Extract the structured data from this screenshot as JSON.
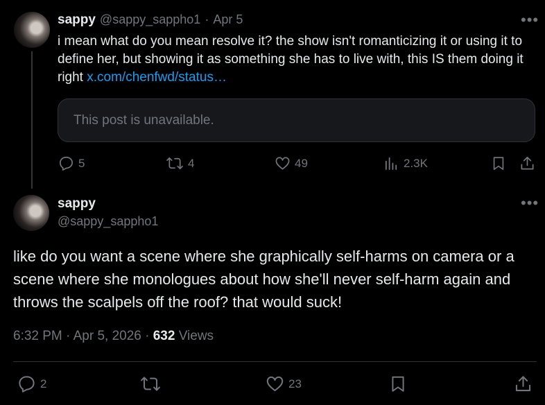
{
  "reply_post": {
    "author_name": "sappy",
    "author_handle": "@sappy_sappho1",
    "separator": "·",
    "date": "Apr 5",
    "text": "i mean what do you mean resolve it? the show isn't romanticizing it or using it to define her, but showing it as something she has to live with, this IS them doing it right ",
    "link_text": "x.com/chenfwd/status…",
    "quoted_placeholder": "This post is unavailable.",
    "stats": {
      "replies": "5",
      "reposts": "4",
      "likes": "49",
      "views": "2.3K"
    },
    "icons": [
      "reply-icon",
      "repost-icon",
      "like-icon",
      "views-icon",
      "bookmark-icon",
      "share-icon",
      "more-icon"
    ]
  },
  "main_post": {
    "author_name": "sappy",
    "author_handle": "@sappy_sappho1",
    "text": "like do you want a scene where she graphically self-harms on camera or a scene where she monologues about how she'll never self-harm again and throws the scalpels off the roof? that would suck!",
    "timestamp": "6:32 PM · Apr 5, 2026",
    "meta_separator": "·",
    "views_count": "632",
    "views_label": "Views",
    "stats": {
      "replies": "2",
      "reposts": "",
      "likes": "23"
    }
  },
  "colors": {
    "background": "#000000",
    "text": "#e7e9ea",
    "muted": "#71767b",
    "link": "#1d9bf0",
    "border": "#2f3336"
  }
}
